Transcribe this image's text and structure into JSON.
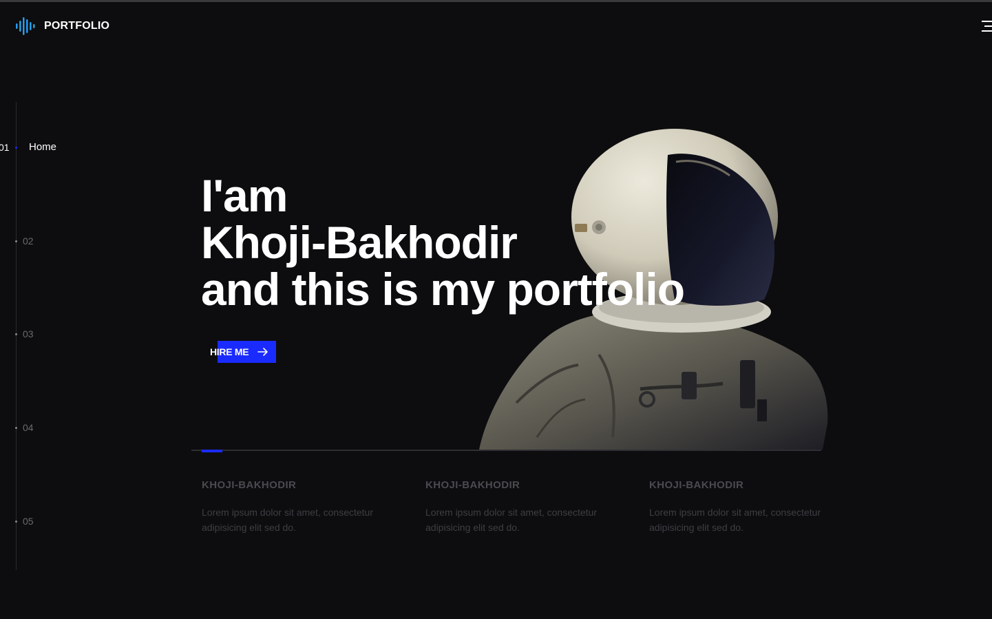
{
  "header": {
    "brand": "PORTFOLIO",
    "logo_icon": "sound-wave-icon",
    "menu_icon": "hamburger-menu-icon"
  },
  "side_nav": {
    "active": {
      "number": "01",
      "label": "Home"
    },
    "items": [
      "02",
      "03",
      "04",
      "05"
    ]
  },
  "hero": {
    "line1": "I'am",
    "line2": "Khoji-Bakhodir",
    "line3": "and this is my portfolio",
    "cta_label": "HIRE ME",
    "cta_icon": "arrow-right-icon"
  },
  "features": [
    {
      "title": "KHOJI-BAKHODIR",
      "text": "Lorem ipsum dolor sit amet, consectetur adipisicing elit sed do."
    },
    {
      "title": "KHOJI-BAKHODIR",
      "text": "Lorem ipsum dolor sit amet, consectetur adipisicing elit sed do."
    },
    {
      "title": "KHOJI-BAKHODIR",
      "text": "Lorem ipsum dolor sit amet, consectetur adipisicing elit sed do."
    }
  ],
  "colors": {
    "background": "#0d0d0f",
    "accent": "#1a2bff",
    "text": "#ffffff"
  }
}
